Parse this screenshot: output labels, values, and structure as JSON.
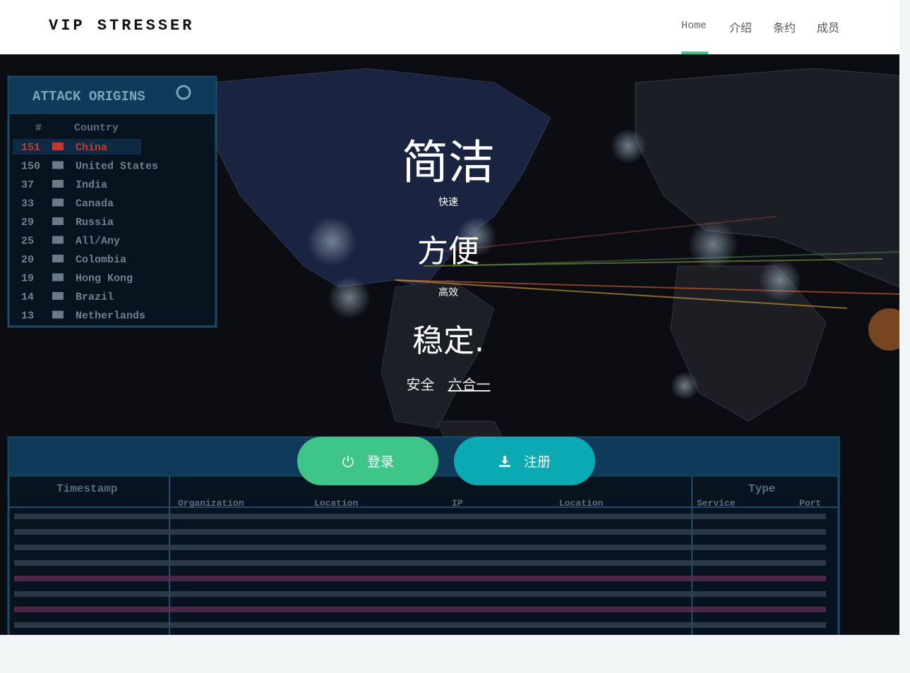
{
  "header": {
    "brand": "VIP STRESSER",
    "nav": [
      "Home",
      "介绍",
      "条约",
      "成员"
    ]
  },
  "hero": {
    "line1": "简洁",
    "sub1": "快速",
    "line2": "方便",
    "sub2": "高效",
    "line3": "稳定.",
    "tagline_left": "安全",
    "tagline_link": "六合一",
    "login_label": "登录",
    "register_label": "注册"
  },
  "background": {
    "attack_origins_title": "ATTACK ORIGINS",
    "origins_header": [
      "#",
      "Country"
    ],
    "origins": [
      [
        "151",
        "China"
      ],
      [
        "150",
        "United States"
      ],
      [
        "37",
        "India"
      ],
      [
        "33",
        "Canada"
      ],
      [
        "29",
        "Russia"
      ],
      [
        "25",
        "All/Any"
      ],
      [
        "20",
        "Colombia"
      ],
      [
        "19",
        "Hong Kong"
      ],
      [
        "14",
        "Brazil"
      ],
      [
        "13",
        "Netherlands"
      ]
    ],
    "log_header": [
      "Timestamp",
      "Organization",
      "Location",
      "IP",
      "Location",
      "Service",
      "Port",
      "Type"
    ]
  },
  "colors": {
    "accent_green": "#3ec688",
    "accent_teal": "#0aa9b3",
    "panel_blue": "#0f3a5a"
  }
}
